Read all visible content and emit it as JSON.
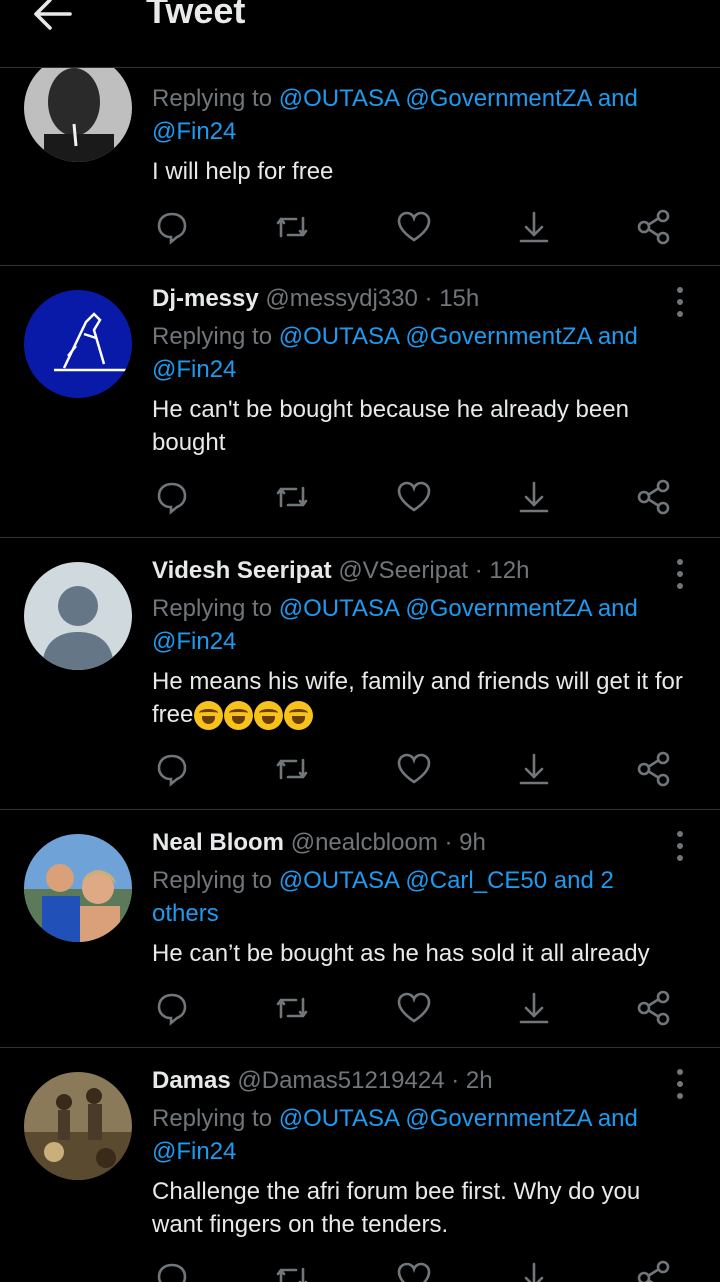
{
  "header": {
    "title": "Tweet"
  },
  "tweets": [
    {
      "display_name": "",
      "handle": "",
      "time": "",
      "replying_label": "Replying to",
      "mentions": [
        "@OUTASA",
        "@GovernmentZA"
      ],
      "mentions_tail": "and",
      "mentions_line2": "@Fin24",
      "text": "I will help for free"
    },
    {
      "display_name": "Dj-messy",
      "handle": "@messydj330",
      "time": "15h",
      "replying_label": "Replying to",
      "mentions": [
        "@OUTASA",
        "@GovernmentZA"
      ],
      "mentions_tail": "and",
      "mentions_line2": "@Fin24",
      "text": "He can't be bought because he already been bought"
    },
    {
      "display_name": "Videsh Seeripat",
      "handle": "@VSeeripat",
      "time": "12h",
      "replying_label": "Replying to",
      "mentions": [
        "@OUTASA",
        "@GovernmentZA"
      ],
      "mentions_tail": "and",
      "mentions_line2": "@Fin24",
      "text": "He means his wife, family and friends will get it for free",
      "emoji_icon": "rolling-on-floor-laughing-icon"
    },
    {
      "display_name": "Neal Bloom",
      "handle": "@nealcbloom",
      "time": "9h",
      "replying_label": "Replying to",
      "mentions": [
        "@OUTASA",
        "@Carl_CE50"
      ],
      "mentions_tail": "and 2",
      "mentions_line2": "others",
      "text": "He can’t be bought as he has sold it all already"
    },
    {
      "display_name": "Damas",
      "handle": "@Damas51219424",
      "time": "2h",
      "replying_label": "Replying to",
      "mentions": [
        "@OUTASA",
        "@GovernmentZA"
      ],
      "mentions_tail": "and",
      "mentions_line2": "@Fin24",
      "text": "Challenge the afri forum bee first. Why do you want fingers on the tenders."
    }
  ],
  "dot_separator": "·",
  "colors": {
    "background": "#000000",
    "accent": "#1d9bf0",
    "muted": "#71767b",
    "text": "#e7e9ea",
    "divider": "#2f3336"
  },
  "icons": [
    "arrow-left-icon",
    "reply-icon",
    "retweet-icon",
    "like-icon",
    "download-icon",
    "share-icon",
    "more-vertical-icon"
  ]
}
